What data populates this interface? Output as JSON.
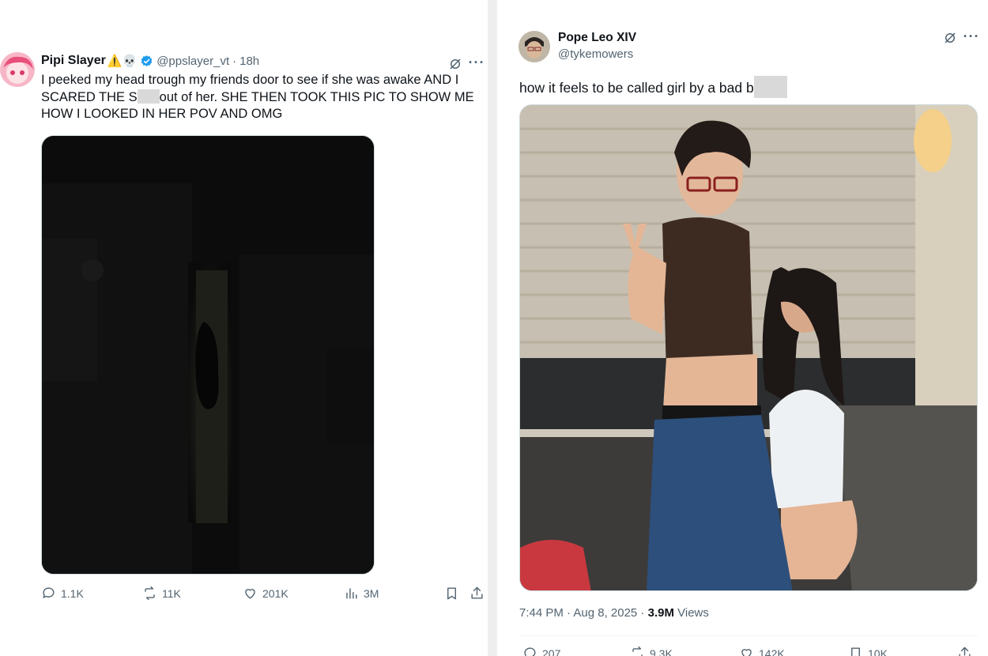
{
  "left_tweet": {
    "display_name": "Pipi Slayer",
    "name_emoji": "⚠️💀",
    "handle": "@ppslayer_vt",
    "separator": "·",
    "time_ago": "18h",
    "text_line1": "I peeked my head trough my friends door to see if she was awake AND I",
    "text_line2_a": "SCARED THE S",
    "text_line2_b": "out of her. SHE THEN TOOK THIS PIC TO SHOW ME",
    "text_line3": "HOW I LOOKED IN HER POV AND OMG",
    "more_label": "···",
    "actions": {
      "replies": "1.1K",
      "reposts": "11K",
      "likes": "201K",
      "views": "3M"
    }
  },
  "right_tweet": {
    "display_name": "Pope Leo XIV",
    "handle": "@tykemowers",
    "text_a": "how it feels to be called girl by a bad b",
    "more_label": "···",
    "timestamp": "7:44 PM · Aug 8, 2025 · ",
    "views_count": "3.9M",
    "views_label": " Views",
    "actions": {
      "replies": "207",
      "reposts": "9.3K",
      "likes": "142K",
      "bookmarks": "10K"
    }
  },
  "colors": {
    "text_primary": "#0f1419",
    "text_secondary": "#536471",
    "verified_blue": "#1d9bf0",
    "divider": "#eeeeee",
    "border": "#cfd9de"
  }
}
